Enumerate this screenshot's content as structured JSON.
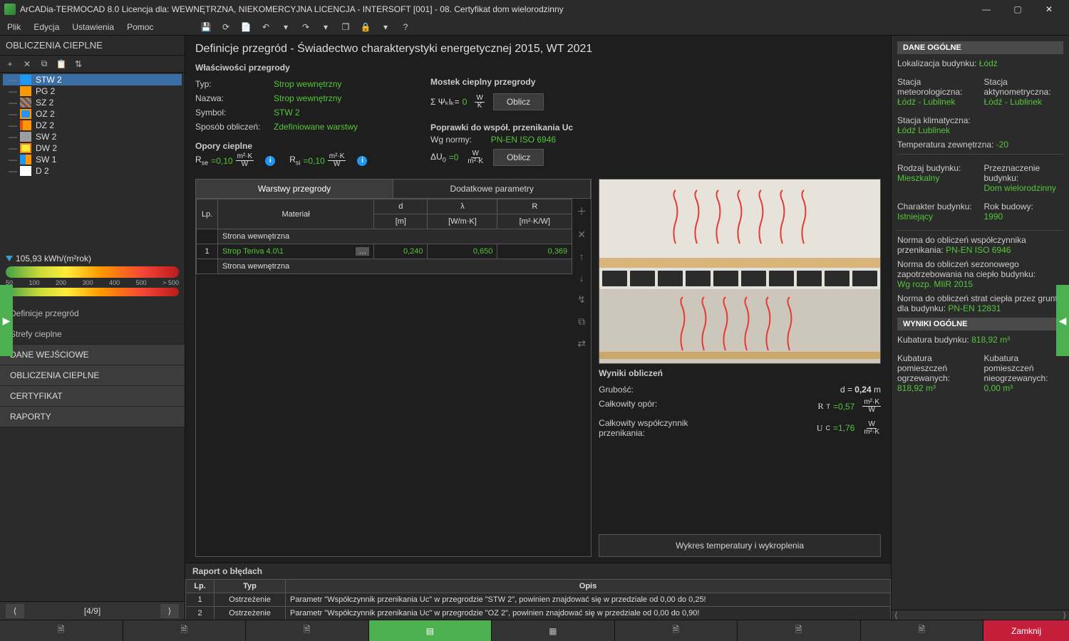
{
  "window": {
    "title": "ArCADia-TERMOCAD 8.0 Licencja dla: WEWNĘTRZNA, NIEKOMERCYJNA LICENCJA - INTERSOFT [001] - 08. Certyfikat dom wielorodzinny"
  },
  "menu": {
    "file": "Plik",
    "edit": "Edycja",
    "settings": "Ustawienia",
    "help": "Pomoc"
  },
  "left_panel": {
    "header": "OBLICZENIA CIEPLNE",
    "tree": [
      {
        "label": "STW 2",
        "ico": "stw",
        "selected": true
      },
      {
        "label": "PG 2",
        "ico": "pg"
      },
      {
        "label": "SZ 2",
        "ico": "sz"
      },
      {
        "label": "OZ 2",
        "ico": "oz"
      },
      {
        "label": "DZ 2",
        "ico": "dz"
      },
      {
        "label": "SW 2",
        "ico": "sw"
      },
      {
        "label": "DW 2",
        "ico": "dw"
      },
      {
        "label": "SW 1",
        "ico": "sw1"
      },
      {
        "label": "D 2",
        "ico": "d2"
      }
    ],
    "energy_value": "105,93 kWh/(m²rok)",
    "scale": [
      "50",
      "100",
      "200",
      "300",
      "400",
      "500",
      "> 500"
    ],
    "nav": [
      {
        "label": "Definicje przegród",
        "type": "sub"
      },
      {
        "label": "Strefy cieplne",
        "type": "sub"
      },
      {
        "label": "DANE WEJŚCIOWE",
        "type": "sec"
      },
      {
        "label": "OBLICZENIA CIEPLNE",
        "type": "sec"
      },
      {
        "label": "CERTYFIKAT",
        "type": "sec"
      },
      {
        "label": "RAPORTY",
        "type": "sec"
      }
    ],
    "pager": "[4/9]"
  },
  "center": {
    "title": "Definicje przegród - Świadectwo charakterystyki energetycznej 2015, WT 2021",
    "props_header": "Właściwości przegrody",
    "type_label": "Typ:",
    "type_value": "Strop wewnętrzny",
    "name_label": "Nazwa:",
    "name_value": "Strop wewnętrzny",
    "symbol_label": "Symbol:",
    "symbol_value": "STW 2",
    "method_label": "Sposób obliczeń:",
    "method_value": "Zdefiniowane warstwy",
    "bridge_header": "Mostek cieplny przegrody",
    "bridge_formula_prefix": "Σ Ψₖlₖ=",
    "bridge_value": "0",
    "bridge_unit_n": "W",
    "bridge_unit_d": "K",
    "calc_button": "Oblicz",
    "opory_header": "Opory cieplne",
    "rse_prefix": "R",
    "rse_val": "=0,10",
    "rse_unit_n": "m²·K",
    "rse_unit_d": "W",
    "rsi_prefix": "R",
    "rsi_val": "=0,10",
    "rsi_unit_n": "m²·K",
    "rsi_unit_d": "W",
    "uc_header": "Poprawki do współ. przenikania Uc",
    "norm_label": "Wg normy:",
    "norm_value": "PN-EN ISO 6946",
    "du_prefix": "ΔU",
    "du_val": "=0",
    "du_unit_n": "W",
    "du_unit_d": "m²·K",
    "tab_layers": "Warstwy przegrody",
    "tab_extra": "Dodatkowe parametry",
    "table": {
      "headers": {
        "lp": "Lp.",
        "material": "Materiał",
        "d": "d",
        "d_unit": "[m]",
        "lambda": "λ",
        "lambda_unit": "[W/m·K]",
        "r": "R",
        "r_unit": "[m²·K/W]"
      },
      "rows": [
        {
          "side": "Strona wewnętrzna"
        },
        {
          "lp": "1",
          "material": "Strop Teriva 4.0\\1",
          "d": "0,240",
          "lambda": "0,650",
          "r": "0,369"
        },
        {
          "side": "Strona wewnętrzna"
        }
      ]
    },
    "results": {
      "header": "Wyniki obliczeń",
      "thickness_label": "Grubość:",
      "thickness_value": "d = 0,24 m",
      "resistance_label": "Całkowity opór:",
      "resistance_prefix": "R",
      "resistance_val": "=0,57",
      "resistance_unit_n": "m²·K",
      "resistance_unit_d": "W",
      "uc_label": "Całkowity współczynnik przenikania:",
      "uc_prefix": "U",
      "uc_val": "=1,76",
      "uc_unit_n": "W",
      "uc_unit_d": "m²·K"
    },
    "chart_button": "Wykres temperatury i wykroplenia"
  },
  "right_panel": {
    "header1": "DANE OGÓLNE",
    "loc_label": "Lokalizacja budynku:",
    "loc_value": "Łódź",
    "meteo_label": "Stacja meteorologiczna:",
    "meteo_value": "Łódź - Lublinek",
    "actino_label": "Stacja aktynometryczna:",
    "actino_value": "Łódź - Lublinek",
    "climate_label": "Stacja klimatyczna:",
    "climate_value": "Łódź Lublinek",
    "temp_label": "Temperatura zewnętrzna:",
    "temp_value": "-20",
    "type_label": "Rodzaj budynku:",
    "type_value": "Mieszkalny",
    "purpose_label": "Przeznaczenie budynku:",
    "purpose_value": "Dom wielorodzinny",
    "char_label": "Charakter budynku:",
    "char_value": "Istniejący",
    "year_label": "Rok budowy:",
    "year_value": "1990",
    "norm1_label": "Norma do obliczeń współczynnika przenikania:",
    "norm1_value": "PN-EN ISO 6946",
    "norm2_label": "Norma do obliczeń sezonowego zapotrzebowania na ciepło budynku:",
    "norm2_value": "Wg rozp. MIiR 2015",
    "norm3_label": "Norma do obliczeń strat ciepła przez grunt dla budynku:",
    "norm3_value": "PN-EN 12831",
    "header2": "WYNIKI OGÓLNE",
    "kub_label": "Kubatura budynku:",
    "kub_value": "818,92 m³",
    "kub_heated_label": "Kubatura pomieszczeń ogrzewanych:",
    "kub_heated_value": "818,92 m³",
    "kub_unheated_label": "Kubatura pomieszczeń nieogrzewanych:",
    "kub_unheated_value": "0,00 m³"
  },
  "report": {
    "title": "Raport o błędach",
    "headers": {
      "lp": "Lp.",
      "type": "Typ",
      "desc": "Opis"
    },
    "rows": [
      {
        "lp": "1",
        "type": "Ostrzeżenie",
        "desc": "Parametr \"Współczynnik przenikania Uc\" w przegrodzie \"STW 2\", powinien znajdować się w przedziale od 0,00 do 0,25!"
      },
      {
        "lp": "2",
        "type": "Ostrzeżenie",
        "desc": "Parametr \"Współczynnik przenikania Uc\" w przegrodzie \"OZ 2\", powinien znajdować się w przedziale od 0,00 do 0,90!"
      }
    ]
  },
  "bottom": {
    "close": "Zamknij"
  }
}
